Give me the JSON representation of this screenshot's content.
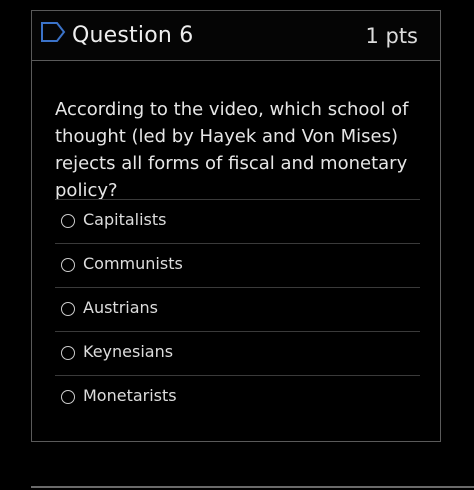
{
  "question": {
    "title": "Question 6",
    "points": "1 pts",
    "text": "According to the video, which school of thought (led by Hayek and Von Mises) rejects all forms of fiscal and monetary policy?",
    "flag_icon": "flag-icon",
    "answers": [
      {
        "label": "Capitalists",
        "selected": false
      },
      {
        "label": "Communists",
        "selected": false
      },
      {
        "label": "Austrians",
        "selected": false
      },
      {
        "label": "Keynesians",
        "selected": false
      },
      {
        "label": "Monetarists",
        "selected": false
      }
    ]
  },
  "colors": {
    "background": "#000000",
    "border": "#5a5a5a",
    "flag": "#3b73c9",
    "text": "#e6e6e6"
  }
}
